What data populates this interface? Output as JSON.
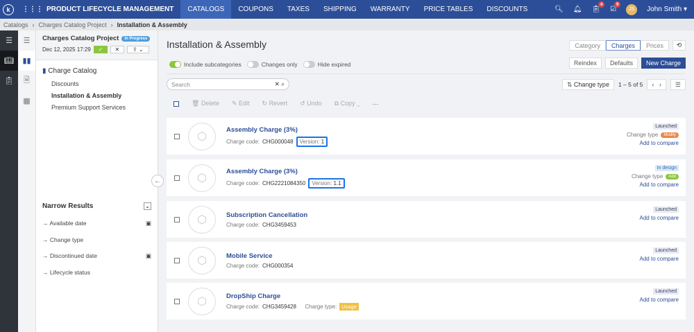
{
  "header": {
    "app_title": "PRODUCT LIFECYCLE MANAGEMENT",
    "nav": [
      "CATALOGS",
      "COUPONS",
      "TAXES",
      "SHIPPING",
      "WARRANTY",
      "PRICE TABLES",
      "DISCOUNTS"
    ],
    "active_nav": "CATALOGS",
    "badge_tasks": "4",
    "badge_checks": "9",
    "avatar_initials": "JS",
    "user": "John Smith"
  },
  "breadcrumb": [
    "Catalogs",
    "Charges Catalog Project",
    "Installation & Assembly"
  ],
  "panel": {
    "project": "Charges Catalog Project",
    "status": "In Progress",
    "date": "Dec 12, 2025 17:29",
    "tree_root": "Charge Catalog",
    "tree_items": [
      "Discounts",
      "Installation & Assembly",
      "Premium Support Services"
    ],
    "narrow_title": "Narrow Results",
    "filters": [
      "Available date",
      "Change type",
      "Discontinued date",
      "Lifecycle status"
    ]
  },
  "main": {
    "title": "Installation & Assembly",
    "views": [
      "Category",
      "Charges",
      "Prices"
    ],
    "active_view": "Charges",
    "toggles": [
      "Include subcategories",
      "Changes only",
      "Hide expired"
    ],
    "reindex": "Reindex",
    "defaults": "Defaults",
    "new_charge": "New Charge",
    "search_placeholder": "Search",
    "sort": "Change type",
    "pager": "1 – 5 of 5",
    "toolbar": [
      "Delete",
      "Edit",
      "Revert",
      "Undo",
      "Copy"
    ],
    "code_label": "Charge code:",
    "version_label": "Version:",
    "change_type_label": "Change type",
    "compare": "Add to compare",
    "charge_type_label": "Charge type:",
    "items": [
      {
        "name": "Assembly Charge (3%)",
        "code": "CHG000048",
        "version": "1",
        "status": "Launched",
        "change_type": "Modify"
      },
      {
        "name": "Assembly Charge (3%)",
        "code": "CHG2221084350",
        "version": "1.1",
        "status": "In design",
        "change_type": "Add"
      },
      {
        "name": "Subscription Cancellation",
        "code": "CHG3459453",
        "status": "Launched"
      },
      {
        "name": "Mobile Service",
        "code": "CHG000354",
        "status": "Launched"
      },
      {
        "name": "DropShip Charge",
        "code": "CHG3459428",
        "status": "Launched",
        "charge_type": "Usage"
      }
    ]
  },
  "colors": {
    "brand": "#2c4e98",
    "modify": "#e8884a",
    "add": "#8cc63f",
    "usage": "#f2c040"
  }
}
